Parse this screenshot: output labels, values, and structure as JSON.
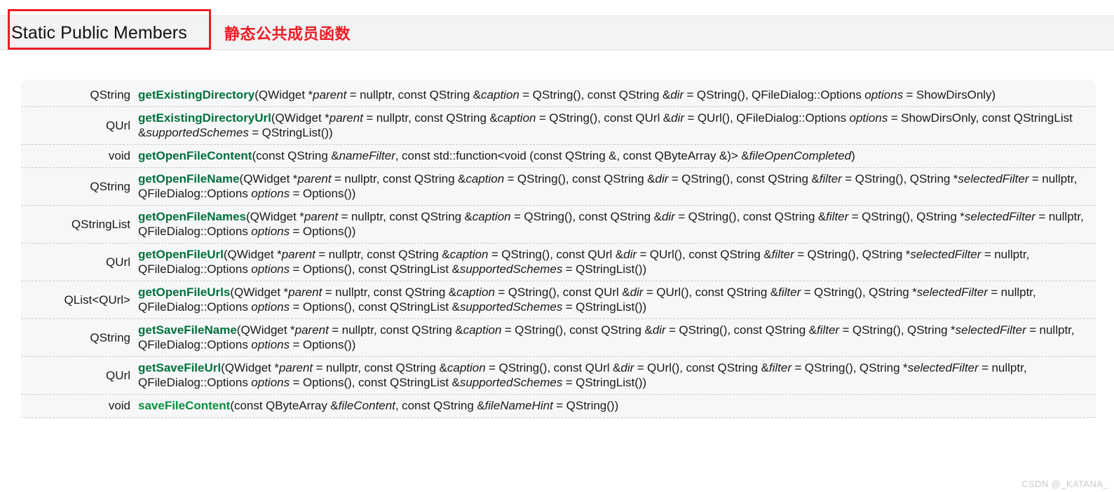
{
  "header": {
    "title": "Static Public Members",
    "subtitle": "静态公共成员函数",
    "highlight_color": "#ee1c25",
    "band_color": "#f2f3f4"
  },
  "table": {
    "accent_color": "#00703c",
    "background_color": "#f6f7f8",
    "rows": [
      {
        "return_type": "QString",
        "name": "getExistingDirectory",
        "signature_parts": [
          {
            "t": "fn",
            "v": "getExistingDirectory"
          },
          {
            "t": "plain",
            "v": "(QWidget *"
          },
          {
            "t": "param",
            "v": "parent"
          },
          {
            "t": "plain",
            "v": " = nullptr, const QString &"
          },
          {
            "t": "param",
            "v": "caption"
          },
          {
            "t": "plain",
            "v": " = QString(), const QString &"
          },
          {
            "t": "param",
            "v": "dir"
          },
          {
            "t": "plain",
            "v": " = QString(), QFileDialog::Options "
          },
          {
            "t": "param",
            "v": "options"
          },
          {
            "t": "plain",
            "v": " = ShowDirsOnly)"
          }
        ]
      },
      {
        "return_type": "QUrl",
        "name": "getExistingDirectoryUrl",
        "signature_parts": [
          {
            "t": "fn",
            "v": "getExistingDirectoryUrl"
          },
          {
            "t": "plain",
            "v": "(QWidget *"
          },
          {
            "t": "param",
            "v": "parent"
          },
          {
            "t": "plain",
            "v": " = nullptr, const QString &"
          },
          {
            "t": "param",
            "v": "caption"
          },
          {
            "t": "plain",
            "v": " = QString(), const QUrl &"
          },
          {
            "t": "param",
            "v": "dir"
          },
          {
            "t": "plain",
            "v": " = QUrl(), QFileDialog::Options "
          },
          {
            "t": "param",
            "v": "options"
          },
          {
            "t": "plain",
            "v": " = ShowDirsOnly, const QStringList &"
          },
          {
            "t": "param",
            "v": "supportedSchemes"
          },
          {
            "t": "plain",
            "v": " = QStringList())"
          }
        ]
      },
      {
        "return_type": "void",
        "name": "getOpenFileContent",
        "signature_parts": [
          {
            "t": "fn",
            "v": "getOpenFileContent"
          },
          {
            "t": "plain",
            "v": "(const QString &"
          },
          {
            "t": "param",
            "v": "nameFilter"
          },
          {
            "t": "plain",
            "v": ", const std::function<void (const QString &, const QByteArray &)> &"
          },
          {
            "t": "param",
            "v": "fileOpenCompleted"
          },
          {
            "t": "plain",
            "v": ")"
          }
        ]
      },
      {
        "return_type": "QString",
        "name": "getOpenFileName",
        "signature_parts": [
          {
            "t": "fn",
            "v": "getOpenFileName"
          },
          {
            "t": "plain",
            "v": "(QWidget *"
          },
          {
            "t": "param",
            "v": "parent"
          },
          {
            "t": "plain",
            "v": " = nullptr, const QString &"
          },
          {
            "t": "param",
            "v": "caption"
          },
          {
            "t": "plain",
            "v": " = QString(), const QString &"
          },
          {
            "t": "param",
            "v": "dir"
          },
          {
            "t": "plain",
            "v": " = QString(), const QString &"
          },
          {
            "t": "param",
            "v": "filter"
          },
          {
            "t": "plain",
            "v": " = QString(), QString *"
          },
          {
            "t": "param",
            "v": "selectedFilter"
          },
          {
            "t": "plain",
            "v": " = nullptr, QFileDialog::Options "
          },
          {
            "t": "param",
            "v": "options"
          },
          {
            "t": "plain",
            "v": " = Options())"
          }
        ]
      },
      {
        "return_type": "QStringList",
        "name": "getOpenFileNames",
        "signature_parts": [
          {
            "t": "fn",
            "v": "getOpenFileNames"
          },
          {
            "t": "plain",
            "v": "(QWidget *"
          },
          {
            "t": "param",
            "v": "parent"
          },
          {
            "t": "plain",
            "v": " = nullptr, const QString &"
          },
          {
            "t": "param",
            "v": "caption"
          },
          {
            "t": "plain",
            "v": " = QString(), const QString &"
          },
          {
            "t": "param",
            "v": "dir"
          },
          {
            "t": "plain",
            "v": " = QString(), const QString &"
          },
          {
            "t": "param",
            "v": "filter"
          },
          {
            "t": "plain",
            "v": " = QString(), QString *"
          },
          {
            "t": "param",
            "v": "selectedFilter"
          },
          {
            "t": "plain",
            "v": " = nullptr, QFileDialog::Options "
          },
          {
            "t": "param",
            "v": "options"
          },
          {
            "t": "plain",
            "v": " = Options())"
          }
        ]
      },
      {
        "return_type": "QUrl",
        "name": "getOpenFileUrl",
        "signature_parts": [
          {
            "t": "fn",
            "v": "getOpenFileUrl"
          },
          {
            "t": "plain",
            "v": "(QWidget *"
          },
          {
            "t": "param",
            "v": "parent"
          },
          {
            "t": "plain",
            "v": " = nullptr, const QString &"
          },
          {
            "t": "param",
            "v": "caption"
          },
          {
            "t": "plain",
            "v": " = QString(), const QUrl &"
          },
          {
            "t": "param",
            "v": "dir"
          },
          {
            "t": "plain",
            "v": " = QUrl(), const QString &"
          },
          {
            "t": "param",
            "v": "filter"
          },
          {
            "t": "plain",
            "v": " = QString(), QString *"
          },
          {
            "t": "param",
            "v": "selectedFilter"
          },
          {
            "t": "plain",
            "v": " = nullptr, QFileDialog::Options "
          },
          {
            "t": "param",
            "v": "options"
          },
          {
            "t": "plain",
            "v": " = Options(), const QStringList &"
          },
          {
            "t": "param",
            "v": "supportedSchemes"
          },
          {
            "t": "plain",
            "v": " = QStringList())"
          }
        ]
      },
      {
        "return_type": "QList<QUrl>",
        "name": "getOpenFileUrls",
        "signature_parts": [
          {
            "t": "fn",
            "v": "getOpenFileUrls"
          },
          {
            "t": "plain",
            "v": "(QWidget *"
          },
          {
            "t": "param",
            "v": "parent"
          },
          {
            "t": "plain",
            "v": " = nullptr, const QString &"
          },
          {
            "t": "param",
            "v": "caption"
          },
          {
            "t": "plain",
            "v": " = QString(), const QUrl &"
          },
          {
            "t": "param",
            "v": "dir"
          },
          {
            "t": "plain",
            "v": " = QUrl(), const QString &"
          },
          {
            "t": "param",
            "v": "filter"
          },
          {
            "t": "plain",
            "v": " = QString(), QString *"
          },
          {
            "t": "param",
            "v": "selectedFilter"
          },
          {
            "t": "plain",
            "v": " = nullptr, QFileDialog::Options "
          },
          {
            "t": "param",
            "v": "options"
          },
          {
            "t": "plain",
            "v": " = Options(), const QStringList &"
          },
          {
            "t": "param",
            "v": "supportedSchemes"
          },
          {
            "t": "plain",
            "v": " = QStringList())"
          }
        ]
      },
      {
        "return_type": "QString",
        "name": "getSaveFileName",
        "signature_parts": [
          {
            "t": "fn",
            "v": "getSaveFileName"
          },
          {
            "t": "plain",
            "v": "(QWidget *"
          },
          {
            "t": "param",
            "v": "parent"
          },
          {
            "t": "plain",
            "v": " = nullptr, const QString &"
          },
          {
            "t": "param",
            "v": "caption"
          },
          {
            "t": "plain",
            "v": " = QString(), const QString &"
          },
          {
            "t": "param",
            "v": "dir"
          },
          {
            "t": "plain",
            "v": " = QString(), const QString &"
          },
          {
            "t": "param",
            "v": "filter"
          },
          {
            "t": "plain",
            "v": " = QString(), QString *"
          },
          {
            "t": "param",
            "v": "selectedFilter"
          },
          {
            "t": "plain",
            "v": " = nullptr, QFileDialog::Options "
          },
          {
            "t": "param",
            "v": "options"
          },
          {
            "t": "plain",
            "v": " = Options())"
          }
        ]
      },
      {
        "return_type": "QUrl",
        "name": "getSaveFileUrl",
        "signature_parts": [
          {
            "t": "fn",
            "v": "getSaveFileUrl"
          },
          {
            "t": "plain",
            "v": "(QWidget *"
          },
          {
            "t": "param",
            "v": "parent"
          },
          {
            "t": "plain",
            "v": " = nullptr, const QString &"
          },
          {
            "t": "param",
            "v": "caption"
          },
          {
            "t": "plain",
            "v": " = QString(), const QUrl &"
          },
          {
            "t": "param",
            "v": "dir"
          },
          {
            "t": "plain",
            "v": " = QUrl(), const QString &"
          },
          {
            "t": "param",
            "v": "filter"
          },
          {
            "t": "plain",
            "v": " = QString(), QString *"
          },
          {
            "t": "param",
            "v": "selectedFilter"
          },
          {
            "t": "plain",
            "v": " = nullptr, QFileDialog::Options "
          },
          {
            "t": "param",
            "v": "options"
          },
          {
            "t": "plain",
            "v": " = Options(), const QStringList &"
          },
          {
            "t": "param",
            "v": "supportedSchemes"
          },
          {
            "t": "plain",
            "v": " = QStringList())"
          }
        ]
      },
      {
        "return_type": "void",
        "name": "saveFileContent",
        "signature_parts": [
          {
            "t": "fn-bright",
            "v": "saveFileContent"
          },
          {
            "t": "plain",
            "v": "(const QByteArray &"
          },
          {
            "t": "param",
            "v": "fileContent"
          },
          {
            "t": "plain",
            "v": ", const QString &"
          },
          {
            "t": "param",
            "v": "fileNameHint"
          },
          {
            "t": "plain",
            "v": " = QString())"
          }
        ]
      }
    ]
  },
  "watermark": {
    "text": "CSDN @_KATANA_"
  }
}
